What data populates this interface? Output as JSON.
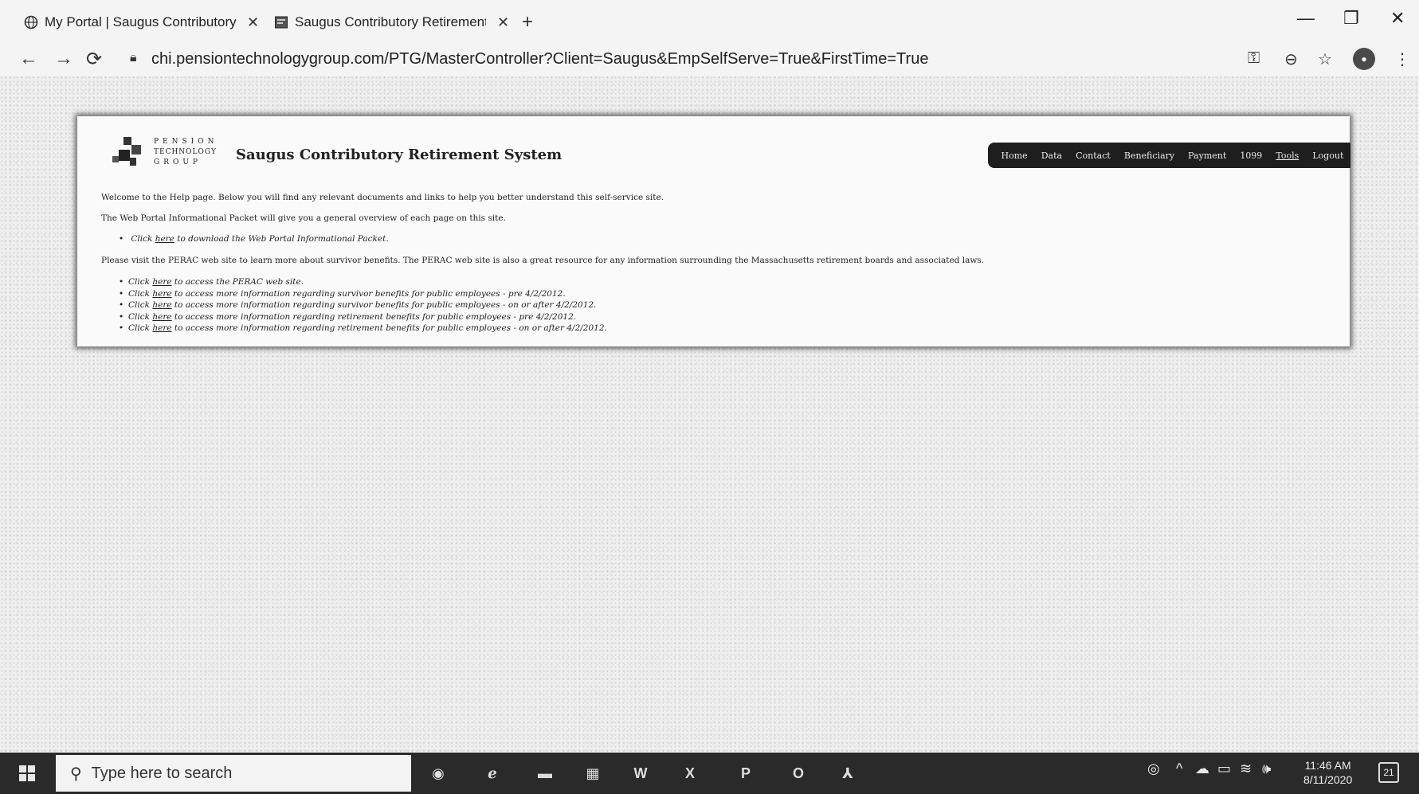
{
  "browser": {
    "tabs": [
      {
        "title": "My Portal | Saugus Contributory",
        "icon": "globe-icon"
      },
      {
        "title": "Saugus Contributory Retirement",
        "icon": "page-icon"
      }
    ],
    "url": "chi.pensiontechnologygroup.com/PTG/MasterController?Client=Saugus&EmpSelfServe=True&FirstTime=True"
  },
  "header": {
    "logo_lines": [
      "PENSION",
      "TECHNOLOGY",
      "GROUP"
    ],
    "title": "Saugus Contributory Retirement System"
  },
  "menu": {
    "items": [
      "Home",
      "Data",
      "Contact",
      "Beneficiary",
      "Payment",
      "1099",
      "Tools",
      "Logout"
    ],
    "active": "Tools"
  },
  "content": {
    "intro": "Welcome to the Help page. Below you will find any relevant documents and links to help you better understand this self-service site.",
    "packet_desc": "The Web Portal Informational Packet will give you a general overview of each page on this site.",
    "packet_link": {
      "prefix": "Click",
      "here": "here",
      "suffix": "to download the Web Portal Informational Packet."
    },
    "perac_desc": "Please visit the PERAC web site to learn more about survivor benefits. The PERAC web site is also a great resource for any information surrounding the Massachusetts retirement boards and associated laws.",
    "perac_links": [
      {
        "prefix": "Click",
        "here": "here",
        "suffix": "to access the PERAC web site."
      },
      {
        "prefix": "Click",
        "here": "here",
        "suffix": "to access more information regarding survivor benefits for public employees - pre 4/2/2012."
      },
      {
        "prefix": "Click",
        "here": "here",
        "suffix": "to access more information regarding survivor benefits for public employees - on or after 4/2/2012."
      },
      {
        "prefix": "Click",
        "here": "here",
        "suffix": "to access more information regarding retirement benefits for public employees - pre 4/2/2012."
      },
      {
        "prefix": "Click",
        "here": "here",
        "suffix": "to access more information regarding retirement benefits for public employees - on or after 4/2/2012."
      }
    ]
  },
  "taskbar": {
    "search_placeholder": "Type here to search",
    "time": "11:46 AM",
    "date": "8/11/2020",
    "notifications": "21"
  }
}
